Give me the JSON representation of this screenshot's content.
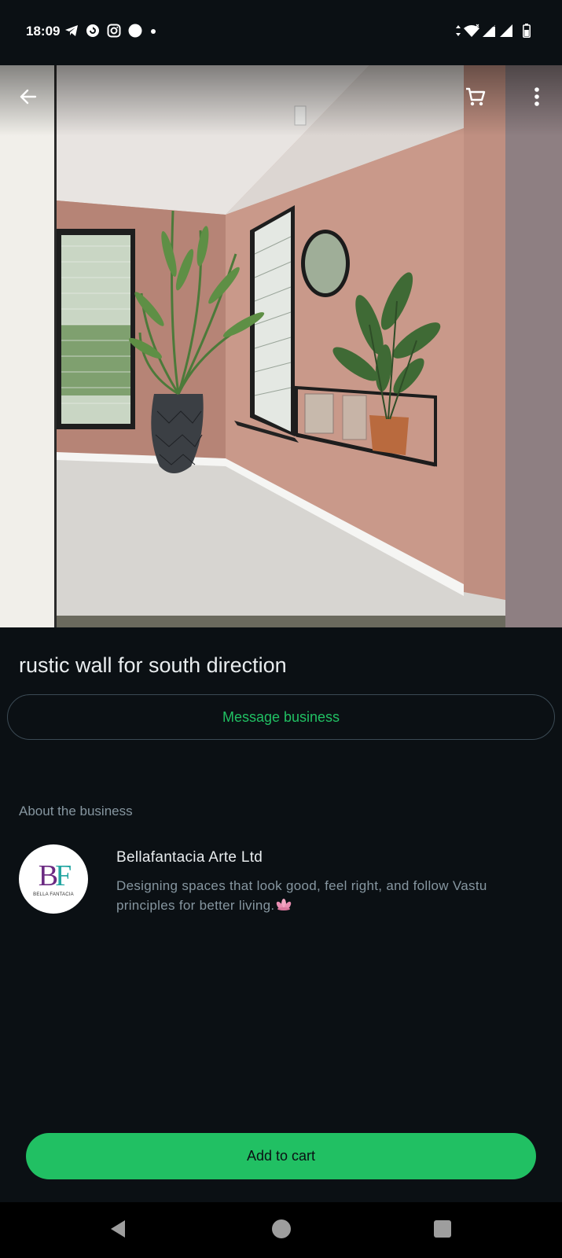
{
  "status_bar": {
    "time": "18:09",
    "left_icons": [
      "telegram-icon",
      "refresh-app-icon",
      "instagram-icon",
      "notification-dot-icon",
      "small-dot-icon"
    ],
    "right_icons": [
      "data-arrows-icon",
      "wifi-icon",
      "signal-icon",
      "signal-icon-2",
      "battery-icon"
    ]
  },
  "header": {
    "back_icon": "arrow-left-icon",
    "cart_icon": "cart-icon",
    "more_icon": "more-vert-icon"
  },
  "product": {
    "title": "rustic wall for south direction",
    "message_button": "Message business"
  },
  "about": {
    "heading": "About the business",
    "logo_letters_b": "B",
    "logo_letters_f": "F",
    "logo_caption": "BELLA FANTACIA",
    "business_name": "Bellafantacia Arte Ltd",
    "description": "Designing spaces that look good, feel right, and follow Vastu principles for better living."
  },
  "footer": {
    "add_to_cart": "Add to cart"
  },
  "nav": {
    "icons": [
      "nav-back-icon",
      "nav-home-icon",
      "nav-recents-icon"
    ]
  },
  "colors": {
    "background": "#0b1014",
    "accent": "#21c063",
    "secondary_text": "#8696a0",
    "primary_text": "#e9edef",
    "outline": "#3b4a54"
  }
}
